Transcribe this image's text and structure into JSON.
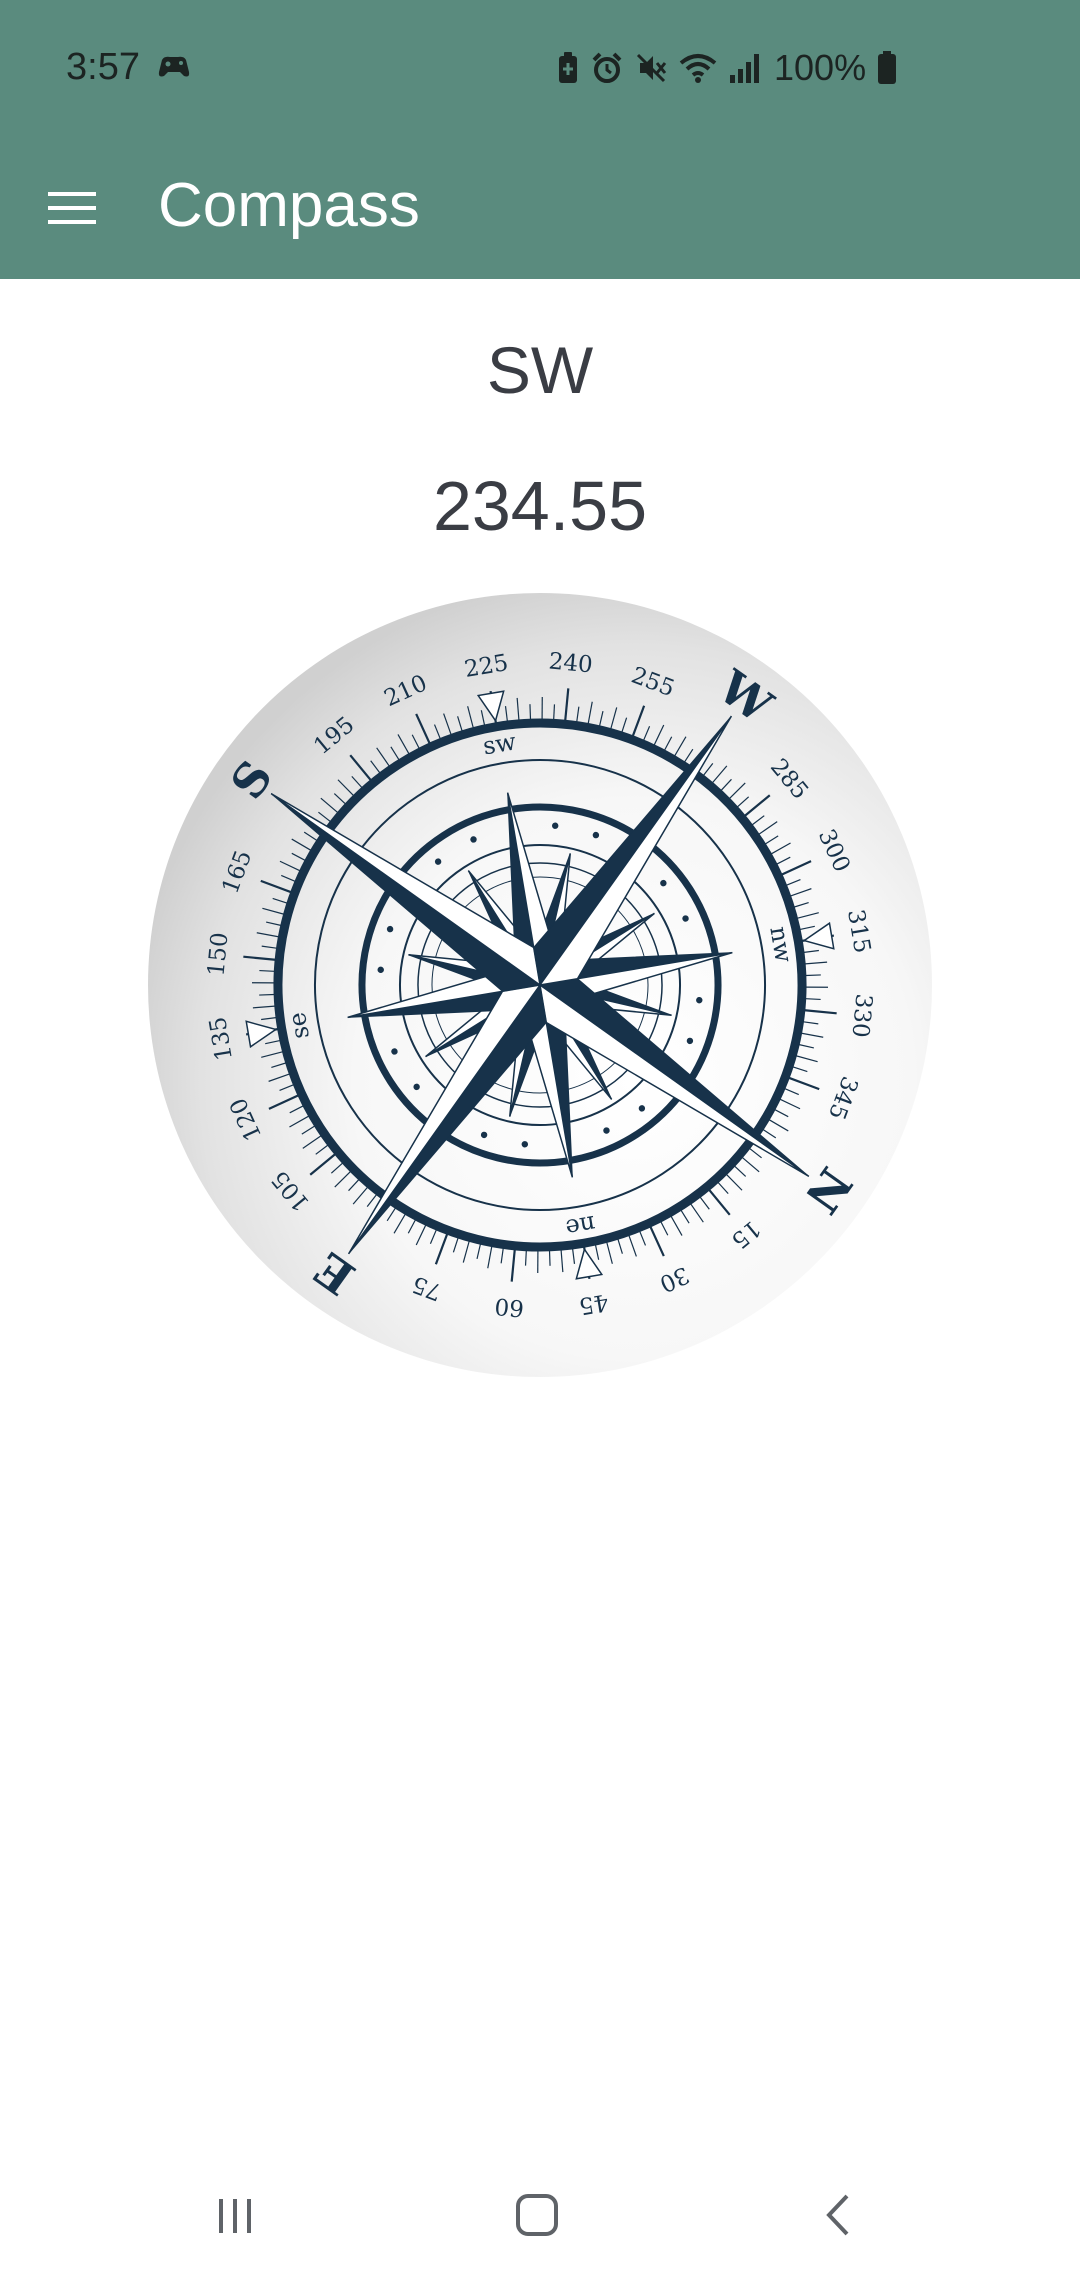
{
  "status_bar": {
    "time": "3:57",
    "battery_percent": "100%",
    "icons": [
      "game-controller-icon",
      "battery-saver-icon",
      "alarm-icon",
      "vibrate-mute-icon",
      "wifi-icon",
      "signal-icon",
      "battery-icon"
    ]
  },
  "app_bar": {
    "title": "Compass",
    "menu_icon": "hamburger-menu-icon"
  },
  "compass": {
    "direction": "SW",
    "heading": "234.55",
    "rose_cardinals": [
      "N",
      "E",
      "S",
      "W"
    ],
    "rose_intercardinals": [
      "ne",
      "se",
      "sw",
      "nw"
    ],
    "dial_numbers": [
      "15",
      "30",
      "45",
      "60",
      "75",
      "105",
      "120",
      "135",
      "150",
      "165",
      "195",
      "210",
      "225",
      "240",
      "255",
      "285",
      "300",
      "315",
      "330",
      "345"
    ]
  },
  "colors": {
    "primary": "#5a8b7e",
    "rose_dark": "#17324a",
    "text": "#3a3d44"
  },
  "nav_bar": {
    "buttons": [
      "recents-icon",
      "home-icon",
      "back-icon"
    ]
  }
}
